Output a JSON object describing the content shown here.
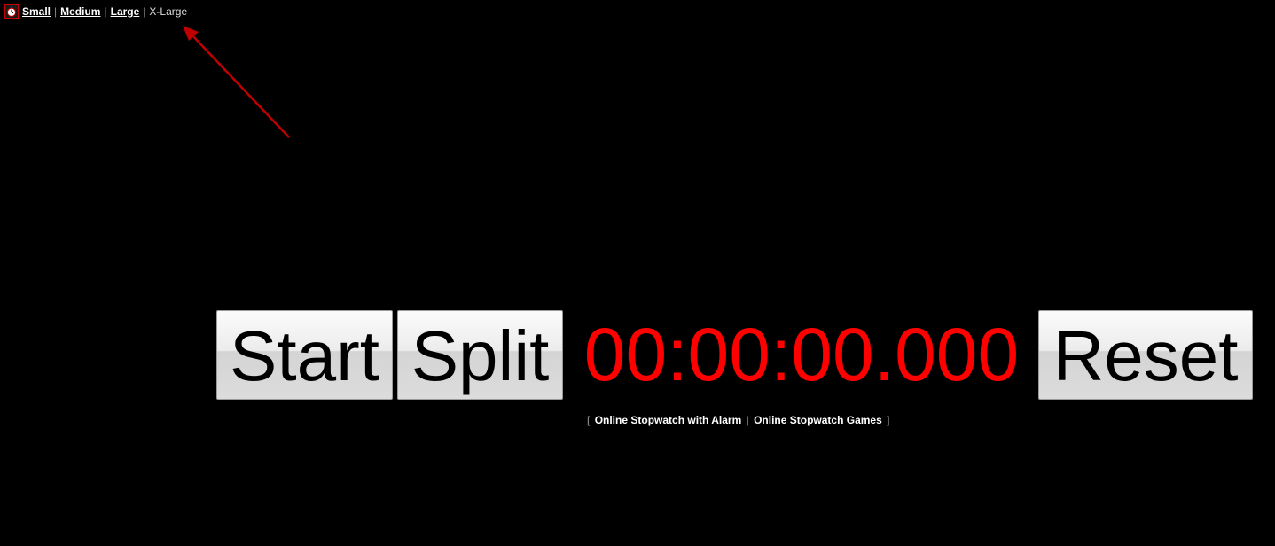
{
  "nav": {
    "logo_icon": "stopwatch-icon",
    "small_label": "Small",
    "medium_label": "Medium",
    "large_label": "Large",
    "xlarge_label": "X-Large",
    "separator": "|"
  },
  "annotation": {
    "arrow_color": "#c00000"
  },
  "controls": {
    "start_label": "Start",
    "split_label": "Split",
    "reset_label": "Reset",
    "time_display": "00:00:00.000",
    "time_color": "#ff0000"
  },
  "footer": {
    "open_bracket": "[",
    "close_bracket": "]",
    "link_alarm": "Online Stopwatch with Alarm",
    "link_games": "Online Stopwatch Games",
    "separator": "|"
  }
}
